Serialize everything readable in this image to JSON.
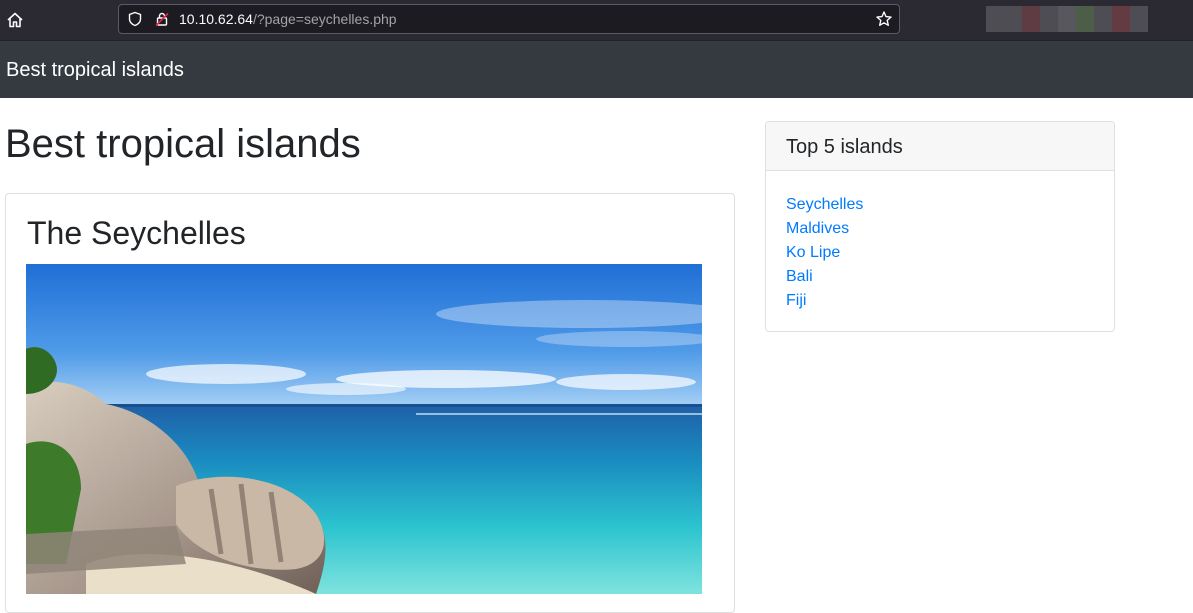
{
  "browser": {
    "url_host": "10.10.62.64",
    "url_path": "/?page=seychelles.php",
    "colors": {
      "chrome_bg": "#2b2a33",
      "urlbar_bg": "#1c1b22"
    }
  },
  "navbar": {
    "brand": "Best tropical islands"
  },
  "main": {
    "title": "Best tropical islands",
    "card": {
      "title": "The Seychelles",
      "image_icon": "beach-photo"
    }
  },
  "sidebar": {
    "title": "Top 5 islands",
    "links": [
      "Seychelles",
      "Maldives",
      "Ko Lipe",
      "Bali",
      "Fiji"
    ]
  },
  "theme": {
    "link_color": "#007bff",
    "navbar_bg": "#343a40",
    "text": "#212529"
  }
}
